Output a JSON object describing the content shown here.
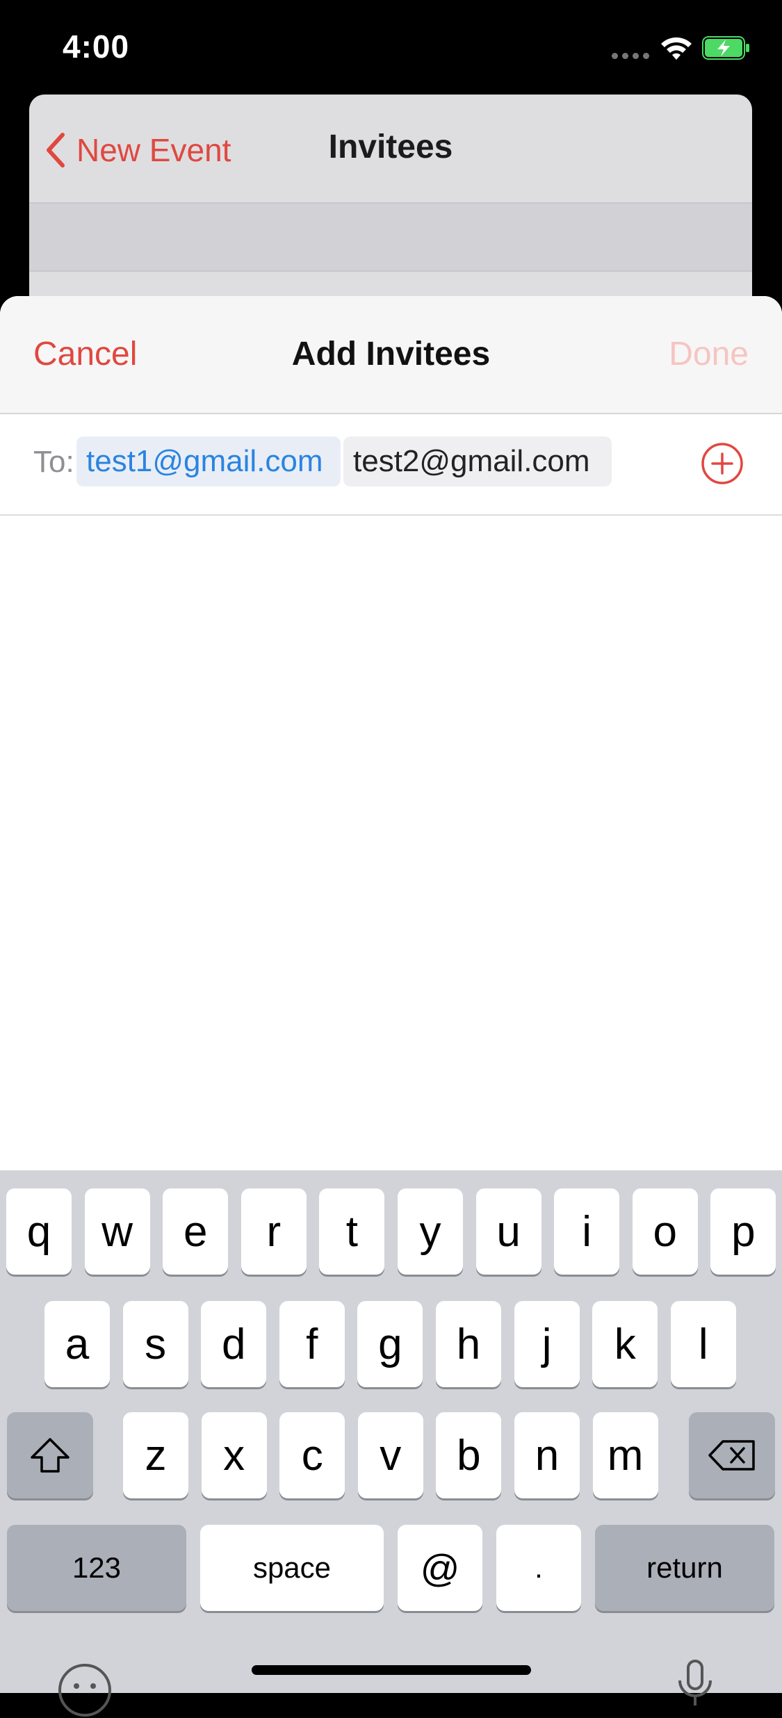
{
  "status_bar": {
    "time": "4:00"
  },
  "background_screen": {
    "back_label": "New Event",
    "title": "Invitees"
  },
  "sheet": {
    "cancel_label": "Cancel",
    "title": "Add Invitees",
    "done_label": "Done",
    "to_label": "To:",
    "invitees": [
      "test1@gmail.com",
      "test2@gmail.com"
    ]
  },
  "keyboard": {
    "row1": [
      "q",
      "w",
      "e",
      "r",
      "t",
      "y",
      "u",
      "i",
      "o",
      "p"
    ],
    "row2": [
      "a",
      "s",
      "d",
      "f",
      "g",
      "h",
      "j",
      "k",
      "l"
    ],
    "row3": [
      "z",
      "x",
      "c",
      "v",
      "b",
      "n",
      "m"
    ],
    "numbers_label": "123",
    "space_label": "space",
    "at_label": "@",
    "dot_label": ".",
    "return_label": "return",
    "shift_icon": "shift-icon",
    "delete_icon": "delete-icon"
  },
  "colors": {
    "accent": "#e0483f",
    "link_blue": "#2a84e0",
    "done_disabled": "#f6c5c1"
  }
}
